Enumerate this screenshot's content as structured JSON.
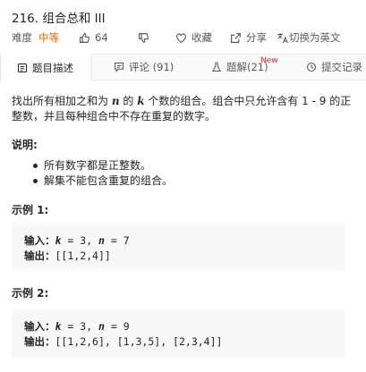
{
  "problem": {
    "title": "216. 组合总和 III",
    "difficulty_label": "难度",
    "difficulty_value": "中等",
    "likes": "64",
    "favorite_label": "收藏",
    "share_label": "分享",
    "lang_label": "切换为英文"
  },
  "tabs": [
    {
      "label": "题目描述"
    },
    {
      "label": "评论 (91)"
    },
    {
      "label": "题解(21)"
    },
    {
      "label": "提交记录"
    }
  ],
  "new_badge": "New",
  "desc": {
    "p1": "找出所有相加之和为 ",
    "n": "n",
    "p2": " 的 ",
    "k": "k",
    "p3": " 个数的组合。组合中只允许含有 1 - 9 的正整数，并且每种组合中不存在重复的数字。"
  },
  "notes": {
    "heading": "说明:",
    "items": [
      "所有数字都是正整数。",
      "解集不能包含重复的组合。"
    ]
  },
  "examples": [
    {
      "heading": "示例 1:",
      "input_label": "输入：",
      "k": "k",
      "eq1": " = 3, ",
      "n": "n",
      "eq2": " = 7",
      "output_label": "输出：",
      "output": "[[1,2,4]]"
    },
    {
      "heading": "示例 2:",
      "input_label": "输入：",
      "k": "k",
      "eq1": " = 3, ",
      "n": "n",
      "eq2": " = 9",
      "output_label": "输出：",
      "output": "[[1,2,6], [1,3,5], [2,3,4]]"
    }
  ],
  "colors": {
    "difficulty": "#ef6c00",
    "new_badge": "#f5222d",
    "code_bg": "#f7f8fa"
  }
}
